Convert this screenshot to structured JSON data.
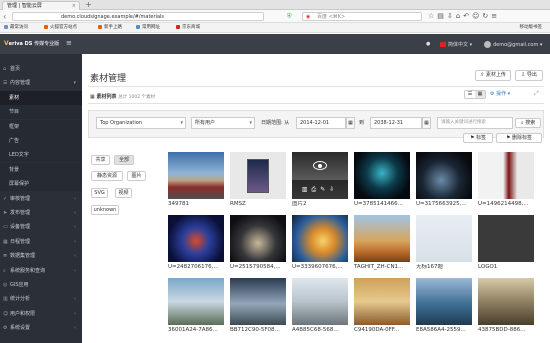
{
  "browser": {
    "tab_title": "管理 | 智能云屏",
    "url": "demo.cloudsignage.example/#/materials",
    "search_placeholder": "百度 <⌘K>",
    "bookmarks": [
      {
        "label": "最常访问",
        "color": "#6b8fd6"
      },
      {
        "label": "火狐官方站点",
        "color": "#e66000"
      },
      {
        "label": "新手上路",
        "color": "#e66000"
      },
      {
        "label": "常用网址",
        "color": "#4a90d9"
      },
      {
        "label": "京东商城",
        "color": "#d22"
      }
    ],
    "bookmarks_right": "移动版书签"
  },
  "app": {
    "logo_mark": "V",
    "logo_text": "eriva DS",
    "logo_sub": "传媒专业版",
    "language": "简体中文",
    "user_email": "demo@gmail.com"
  },
  "sidebar": {
    "items": [
      {
        "label": "首页",
        "icon": "home-icon",
        "type": "group"
      },
      {
        "label": "内容管理",
        "icon": "list-icon",
        "type": "group",
        "chev": "▾"
      },
      {
        "label": "素材",
        "type": "sub",
        "active": true
      },
      {
        "label": "节目",
        "type": "sub"
      },
      {
        "label": "框架",
        "type": "sub"
      },
      {
        "label": "广告",
        "type": "sub"
      },
      {
        "label": "LED文字",
        "type": "sub"
      },
      {
        "label": "背景",
        "type": "sub"
      },
      {
        "label": "屏幕保护",
        "type": "sub"
      },
      {
        "label": "审核管理",
        "icon": "check-icon",
        "type": "group",
        "chev": "‹"
      },
      {
        "label": "发布管理",
        "icon": "send-icon",
        "type": "group",
        "chev": "‹"
      },
      {
        "label": "设备管理",
        "icon": "monitor-icon",
        "type": "group",
        "chev": "‹"
      },
      {
        "label": "日程管理",
        "icon": "calendar-icon",
        "type": "group",
        "chev": "‹"
      },
      {
        "label": "数据集管理",
        "icon": "database-icon",
        "type": "group",
        "chev": "‹"
      },
      {
        "label": "系统服务和查询",
        "icon": "search-icon",
        "type": "group",
        "chev": "‹"
      },
      {
        "label": "GIS应用",
        "icon": "map-icon",
        "type": "group"
      },
      {
        "label": "统计分析",
        "icon": "chart-icon",
        "type": "group",
        "chev": "‹"
      },
      {
        "label": "用户和权限",
        "icon": "user-icon",
        "type": "group",
        "chev": "‹"
      },
      {
        "label": "系统设置",
        "icon": "gear-icon",
        "type": "group",
        "chev": "‹"
      }
    ]
  },
  "main": {
    "title": "素材管理",
    "upload_label": "素材上传",
    "export_label": "导出",
    "list_title": "素材列表",
    "list_count": "总计 1002 个素材",
    "ops_label": "操作",
    "filters": {
      "org": "Top Organization",
      "user": "所有用户",
      "date_label": "日期范围: 从",
      "date_from": "2014-12-01",
      "date_to_label": "到",
      "date_to": "2038-12-31",
      "keyword_placeholder": "请输入关键词进行搜索",
      "search_label": "搜索",
      "tag_btn": "标签",
      "delete_tag_btn": "删除标签"
    },
    "tags": [
      "共享",
      "全部",
      "静态资源",
      "图片",
      "SVG",
      "视频",
      "unknown"
    ],
    "thumbnails": [
      {
        "caption": "349781",
        "bg": "linear-gradient(#3c6fa8 0%, #8fb4d6 45%, #b9a58a 60%, #8a2d2a 75%, #505050 100%)"
      },
      {
        "caption": "RMSZ",
        "bg": "#e8e8e8",
        "mini": true
      },
      {
        "caption": "图片2",
        "bg": "linear-gradient(#2a2a2a, #7d7d7d)",
        "overlay": true
      },
      {
        "caption": "U=3785141466...",
        "bg": "radial-gradient(circle at 50% 45%, #3bb4c6 0%, #0c3b4a 40%, #050a10 75%)"
      },
      {
        "caption": "U=3175663925,...",
        "bg": "radial-gradient(circle at 45% 60%, #6a8aa8 0%, #1a2634 45%, #07090d 80%)"
      },
      {
        "caption": "U=1496214498,...",
        "bg": "linear-gradient(90deg, #f2f2f2 0%, #f2f2f2 45%, #7a1414 55%, #e9e9e9 70%)"
      },
      {
        "caption": "U=2482706176,...",
        "bg": "radial-gradient(circle at 50% 55%, #d84b2a 0%, #2a3f9c 35%, #0a0f35 75%)"
      },
      {
        "caption": "U=2515790584,...",
        "bg": "radial-gradient(circle at 50% 60%, #c9b89a 0%, #34363a 45%, #0e0f12 80%)"
      },
      {
        "caption": "U=3339607676,...",
        "bg": "radial-gradient(circle at 55% 55%, #f7d26a 0%, #d98b2a 30%, #2b5e9c 65%, #11203c 100%)"
      },
      {
        "caption": "TAGHIT_ZH-CN1...",
        "bg": "linear-gradient(#9fc4e6 0%, #d7a55e 55%, #b8692a 80%, #7a3f18 100%)"
      },
      {
        "caption": "无标167题",
        "bg": "linear-gradient(#e9eef3, #d8e0e6)"
      },
      {
        "caption": "LOGO1",
        "bg": "#3a3a3a"
      },
      {
        "caption": "36001A24-7A86...",
        "bg": "linear-gradient(#7aa6c9 0%, #c9d8e2 50%, #5a6e56 100%)"
      },
      {
        "caption": "BB712C90-5F08...",
        "bg": "linear-gradient(#2a3b52 0%, #93a6b8 55%, #3e4b55 100%)"
      },
      {
        "caption": "A4B85C68-568...",
        "bg": "linear-gradient(#dfe7ee 0%, #b9c3cb 50%, #6c757b 100%)"
      },
      {
        "caption": "C94190DA-0FF...",
        "bg": "linear-gradient(#cfa15c 0%, #e6c98d 50%, #8a5c2e 100%)"
      },
      {
        "caption": "E8A586A4-2559...",
        "bg": "linear-gradient(#9ab9d6 0%, #3f6f95 55%, #1f3b52 100%)"
      },
      {
        "caption": "43875BDD-886...",
        "bg": "linear-gradient(#d8c9a8 0%, #8f8063 50%, #4a3f2c 100%)"
      }
    ]
  }
}
